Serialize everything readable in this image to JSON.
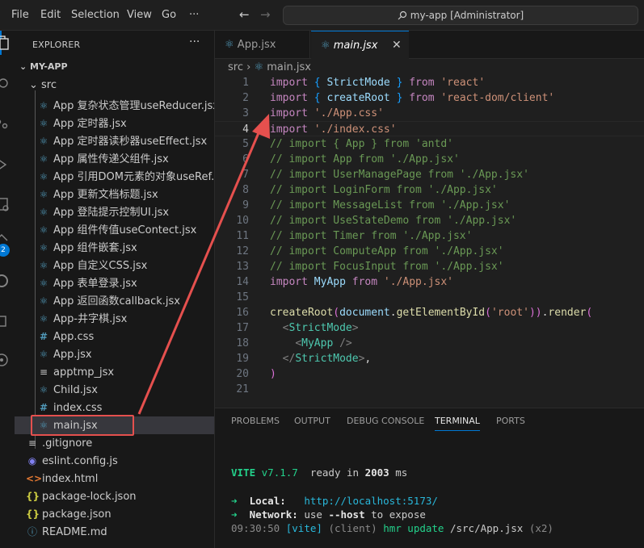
{
  "menu": [
    "File",
    "Edit",
    "Selection",
    "View",
    "Go",
    "···"
  ],
  "command_center": "my-app [Administrator]",
  "explorer": {
    "title": "EXPLORER",
    "more": "···",
    "root": "MY-APP",
    "src": "src",
    "files": [
      {
        "icon": "react",
        "name": "App 复杂状态管理useReducer.jsx"
      },
      {
        "icon": "react",
        "name": "App 定时器.jsx"
      },
      {
        "icon": "react",
        "name": "App 定时器读秒器useEffect.jsx"
      },
      {
        "icon": "react",
        "name": "App 属性传递父组件.jsx"
      },
      {
        "icon": "react",
        "name": "App 引用DOM元素的对象useRef.j..."
      },
      {
        "icon": "react",
        "name": "App 更新文档标题.jsx"
      },
      {
        "icon": "react",
        "name": "App 登陆提示控制UI.jsx"
      },
      {
        "icon": "react",
        "name": "App 组件传值useContect.jsx"
      },
      {
        "icon": "react",
        "name": "App 组件嵌套.jsx"
      },
      {
        "icon": "react",
        "name": "App 自定义CSS.jsx"
      },
      {
        "icon": "react",
        "name": "App 表单登录.jsx"
      },
      {
        "icon": "react",
        "name": "App 返回函数callback.jsx"
      },
      {
        "icon": "react",
        "name": "App-井字棋.jsx"
      },
      {
        "icon": "hash",
        "name": "App.css"
      },
      {
        "icon": "react",
        "name": "App.jsx"
      },
      {
        "icon": "lines",
        "name": "apptmp_jsx"
      },
      {
        "icon": "react",
        "name": "Child.jsx"
      },
      {
        "icon": "hash",
        "name": "index.css"
      },
      {
        "icon": "react",
        "name": "main.jsx"
      }
    ],
    "root_files": [
      {
        "icon": "lines",
        "name": ".gitignore"
      },
      {
        "icon": "eslint",
        "name": "eslint.config.js"
      },
      {
        "icon": "html",
        "name": "index.html"
      },
      {
        "icon": "curly",
        "name": "package-lock.json"
      },
      {
        "icon": "curly",
        "name": "package.json"
      },
      {
        "icon": "info",
        "name": "README.md"
      }
    ]
  },
  "tabs": [
    {
      "label": "App.jsx",
      "active": false
    },
    {
      "label": "main.jsx",
      "active": true,
      "close": "✕"
    }
  ],
  "breadcrumb": {
    "folder": "src",
    "sep": "›",
    "file": "main.jsx"
  },
  "code": {
    "line_numbers": [
      "1",
      "2",
      "3",
      "4",
      "5",
      "6",
      "7",
      "8",
      "9",
      "10",
      "11",
      "12",
      "13",
      "14",
      "15",
      "16",
      "17",
      "18",
      "19",
      "20",
      "21"
    ],
    "lines": [
      "import { StrictMode } from 'react'",
      "import { createRoot } from 'react-dom/client'",
      "import './App.css'",
      "import './index.css'",
      "// import { App } from 'antd'",
      "// import App from './App.jsx'",
      "// import UserManagePage from './App.jsx'",
      "// import LoginForm from './App.jsx'",
      "// import MessageList from './App.jsx'",
      "// import UseStateDemo from './App.jsx'",
      "// import Timer from './App.jsx'",
      "// import ComputeApp from './App.jsx'",
      "// import FocusInput from './App.jsx'",
      "import MyApp from './App.jsx'",
      "",
      "createRoot(document.getElementById('root')).render(",
      "  <StrictMode>",
      "    <MyApp />",
      "  </StrictMode>,",
      ")",
      ""
    ]
  },
  "panel": {
    "tabs": [
      "PROBLEMS",
      "OUTPUT",
      "DEBUG CONSOLE",
      "TERMINAL",
      "PORTS"
    ],
    "active_tab": "TERMINAL",
    "terminal": {
      "vite": "VITE",
      "version": "v7.1.7",
      "ready_text": "ready in",
      "ready_ms": "2003",
      "ms": "ms",
      "local_label": "Local:",
      "local_url": "http://localhost:5173/",
      "network_label": "Network:",
      "network_pre": "use",
      "network_flag": "--host",
      "network_post": "to expose",
      "time": "09:30:50",
      "tag": "[vite]",
      "client": "(client)",
      "hmr": "hmr update",
      "file": "/src/App.jsx",
      "count": "(x2)"
    }
  },
  "colors": {
    "accent": "#0078d4",
    "annotation": "#e5504e"
  }
}
